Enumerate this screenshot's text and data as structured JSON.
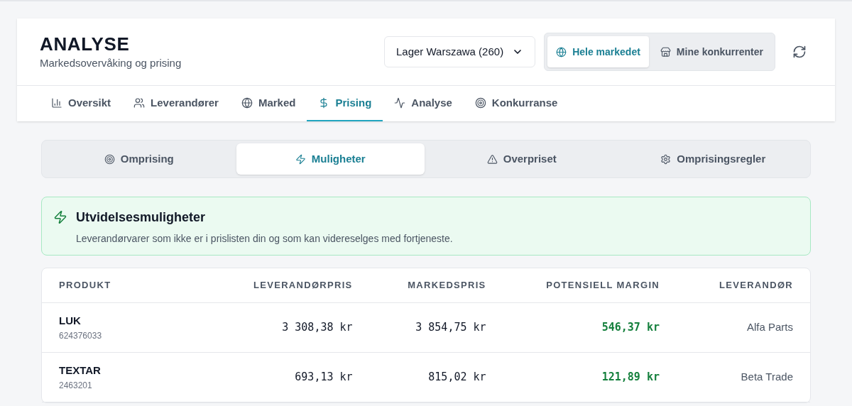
{
  "header": {
    "title": "ANALYSE",
    "subtitle": "Markedsovervåking og prising",
    "warehouse_select": {
      "value": "Lager Warszawa (260)"
    },
    "scope_toggle": [
      {
        "label": "Hele markedet",
        "kind": "globe",
        "selected": true
      },
      {
        "label": "Mine konkurrenter",
        "kind": "store",
        "selected": false
      }
    ]
  },
  "nav_tabs": [
    {
      "label": "Oversikt",
      "kind": "chart",
      "selected": false
    },
    {
      "label": "Leverandører",
      "kind": "users",
      "selected": false
    },
    {
      "label": "Marked",
      "kind": "globe",
      "selected": false
    },
    {
      "label": "Prising",
      "kind": "dollar",
      "selected": true
    },
    {
      "label": "Analyse",
      "kind": "activity",
      "selected": false
    },
    {
      "label": "Konkurranse",
      "kind": "target",
      "selected": false
    }
  ],
  "sub_tabs": [
    {
      "label": "Omprising",
      "kind": "target",
      "selected": false
    },
    {
      "label": "Muligheter",
      "kind": "zap",
      "selected": true
    },
    {
      "label": "Overpriset",
      "kind": "alert",
      "selected": false
    },
    {
      "label": "Omprisingsregler",
      "kind": "gear",
      "selected": false
    }
  ],
  "notice": {
    "title": "Utvidelsesmuligheter",
    "text": "Leverandørvarer som ikke er i prislisten din og som kan videreselges med fortjeneste."
  },
  "table": {
    "columns": [
      "PRODUKT",
      "LEVERANDØRPRIS",
      "MARKEDSPRIS",
      "POTENSIELL MARGIN",
      "LEVERANDØR"
    ],
    "rows": [
      {
        "product": "LUK",
        "code": "624376033",
        "supplier_price": "3 308,38 kr",
        "market_price": "3 854,75 kr",
        "margin": "546,37 kr",
        "supplier": "Alfa Parts"
      },
      {
        "product": "TEXTAR",
        "code": "2463201",
        "supplier_price": "693,13 kr",
        "market_price": "815,02 kr",
        "margin": "121,89 kr",
        "supplier": "Beta Trade"
      }
    ]
  }
}
